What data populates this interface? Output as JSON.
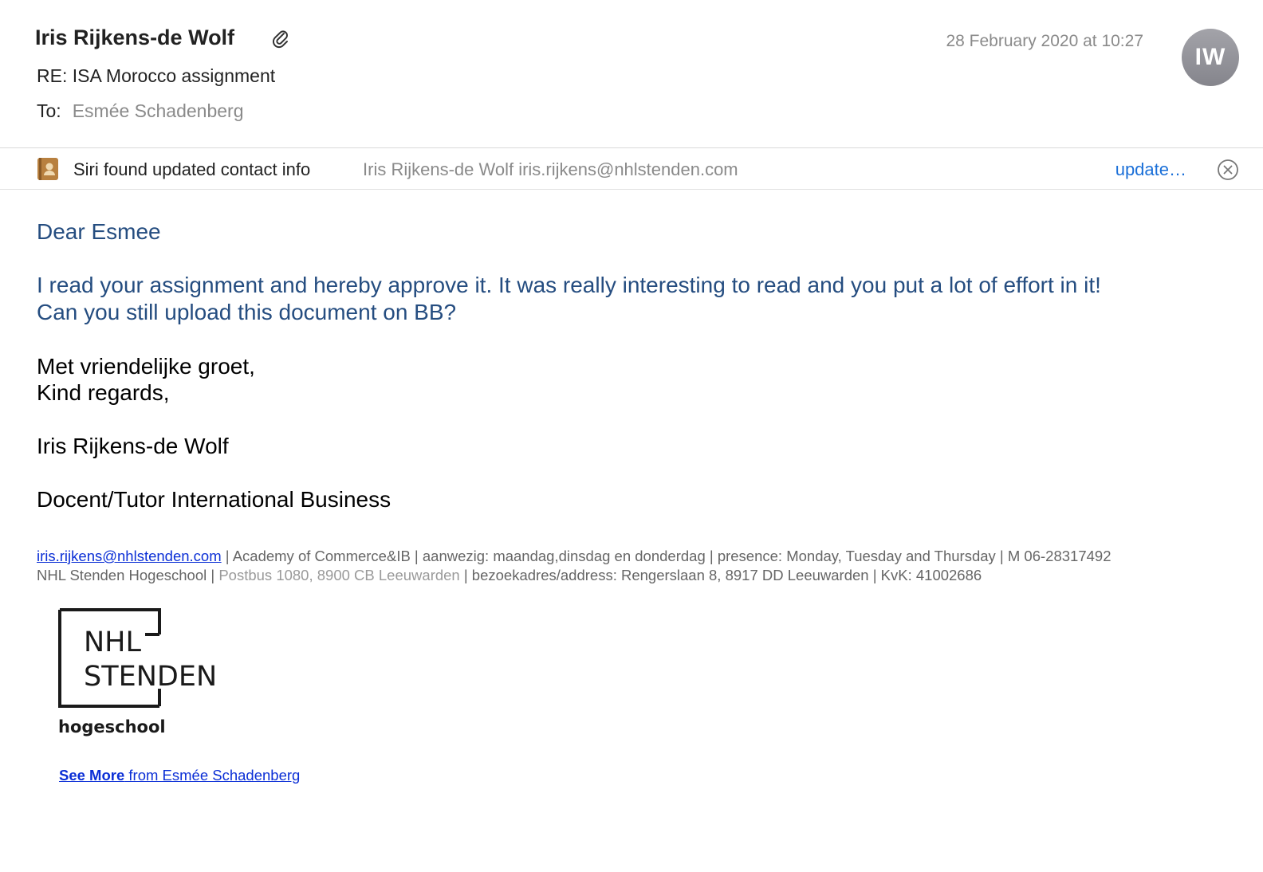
{
  "message": {
    "sender": "Iris Rijkens-de Wolf",
    "subject": "RE: ISA Morocco assignment",
    "to_label": "To:",
    "to_name": "Esmée Schadenberg",
    "date": "28 February 2020 at 10:27",
    "avatar_initials": "IW"
  },
  "siri": {
    "text": "Siri found updated contact info",
    "contact": "Iris Rijkens-de Wolf iris.rijkens@nhlstenden.com",
    "update_label": "update…"
  },
  "body": {
    "greeting": "Dear Esmee",
    "line1": "I read your assignment and hereby approve it. It was really interesting to read and you put a lot of effort in it!",
    "line2": "Can you still upload this document on BB?",
    "closing1": "Met vriendelijke groet,",
    "closing2": "Kind regards,",
    "name": "Iris Rijkens-de Wolf",
    "role": "Docent/Tutor International Business"
  },
  "signature": {
    "email": "iris.rijkens@nhlstenden.com",
    "line1_rest": " | Academy of Commerce&IB | aanwezig: maandag,dinsdag en donderdag | presence: Monday, Tuesday and Thursday | M 06-28317492",
    "line2_start": "NHL Stenden Hogeschool | ",
    "line2_postbus": "Postbus 1080, 8900 CB Leeuwarden",
    "line2_rest": " | bezoekadres/address: Rengerslaan 8, 8917 DD Leeuwarden | KvK: 41002686"
  },
  "logo": {
    "line1": "NHL",
    "line2": "STENDEN",
    "line3": "hogeschool"
  },
  "see_more": {
    "bold": "See More",
    "rest": " from Esmée Schadenberg"
  },
  "colors": {
    "body_blue": "#254d80",
    "link_blue": "#0b2fd6",
    "update_blue": "#1a6fd8",
    "avatar_gray": "#95959b"
  }
}
